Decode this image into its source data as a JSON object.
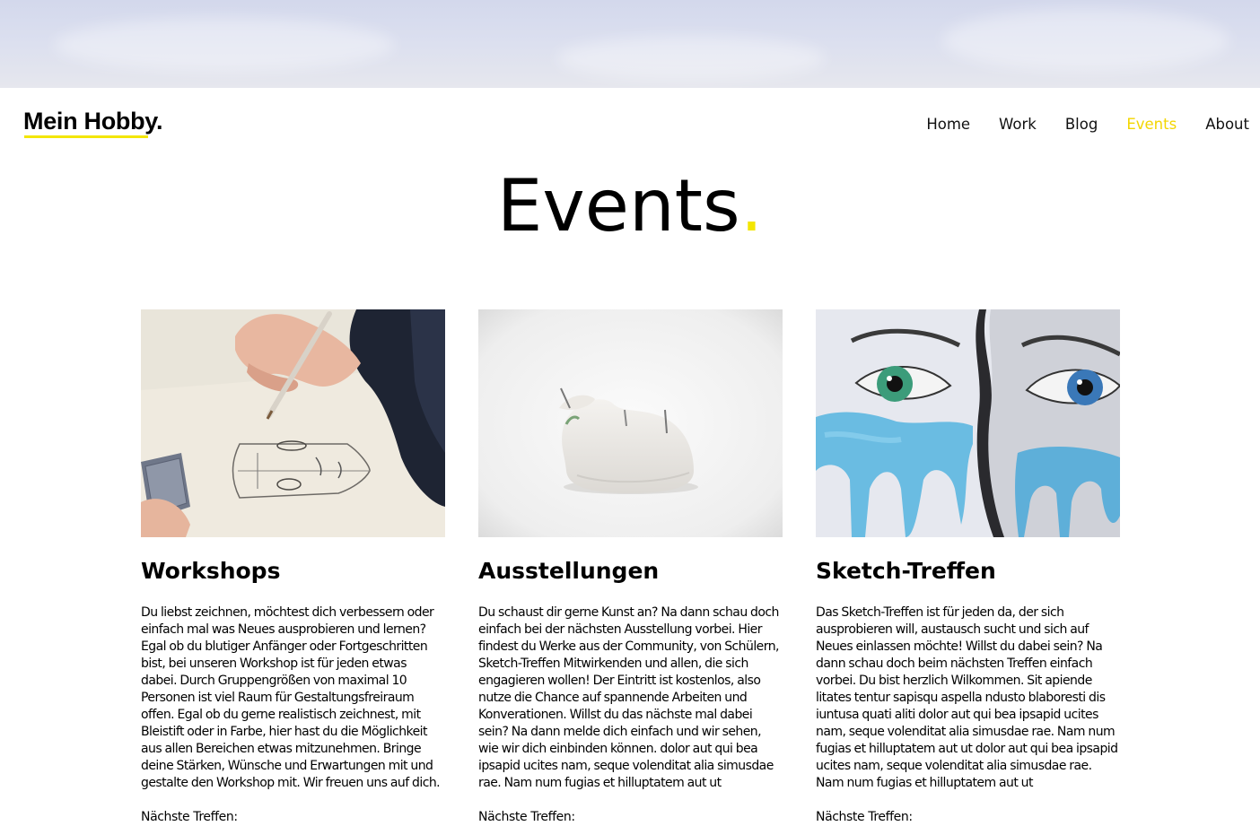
{
  "header": {
    "logo": "Mein Hobby.",
    "nav": [
      {
        "label": "Home"
      },
      {
        "label": "Work"
      },
      {
        "label": "Blog"
      },
      {
        "label": "Events",
        "active": true
      },
      {
        "label": "About"
      }
    ]
  },
  "page": {
    "title": "Events",
    "title_dot": "."
  },
  "cards": [
    {
      "title": "Workshops",
      "text": "Du liebst zeichnen, möchtest dich verbessern oder einfach mal was Neues ausprobieren und lernen? Egal ob du blutiger Anfänger oder Fortgeschritten bist, bei unseren Workshop ist für jeden etwas dabei. Durch Gruppengrößen von maximal 10 Personen ist viel Raum für Gestaltungsfreiraum offen. Egal ob du gerne realistisch zeichnest, mit Bleistift oder in Farbe, hier hast du die Möglichkeit aus allen Bereichen etwas mitzunehmen. Bringe deine Stärken, Wünsche und Erwartungen mit und gestalte den Workshop mit. Wir freuen uns auf dich.",
      "next_label": "Nächste Treffen:",
      "image": "drawing-workshop-photo"
    },
    {
      "title": "Ausstellungen",
      "text": "Du schaust dir gerne Kunst an? Na dann schau doch einfach bei der nächsten Ausstellung vorbei. Hier findest du Werke aus der Community, von Schülern, Sketch-Treffen Mitwirkenden und allen, die sich engagieren wollen! Der Eintritt ist kostenlos, also nutze die Chance auf spannende Arbeiten und Konverationen. Willst du das nächste mal dabei sein? Na dann melde dich einfach und wir sehen, wie wir dich einbinden können. dolor aut qui bea ipsapid ucites nam, seque volenditat alia simusdae rae. Nam num fugias et hilluptatem aut ut",
      "next_label": "Nächste Treffen:",
      "image": "clay-sculpture-photo"
    },
    {
      "title": "Sketch-Treffen",
      "text": "Das Sketch-Treffen ist für jeden da, der sich ausprobieren will, austausch sucht und sich auf Neues einlassen möchte! Willst du dabei sein? Na dann schau doch beim nächsten Treffen einfach vorbei. Du bist herzlich Wilkommen. Sit apiende litates tentur sapisqu aspella ndusto blaboresti dis iuntusa quati aliti dolor aut qui bea ipsapid ucites nam, seque volenditat alia simusdae rae. Nam num fugias et hilluptatem aut ut dolor aut qui bea ipsapid ucites nam, seque volenditat alia simusdae rae. Nam num fugias et hilluptatem aut ut",
      "next_label": "Nächste Treffen:",
      "image": "watercolor-eyes-painting"
    }
  ],
  "colors": {
    "accent": "#f3e600",
    "nav_active": "#f3d600",
    "text": "#000000"
  }
}
